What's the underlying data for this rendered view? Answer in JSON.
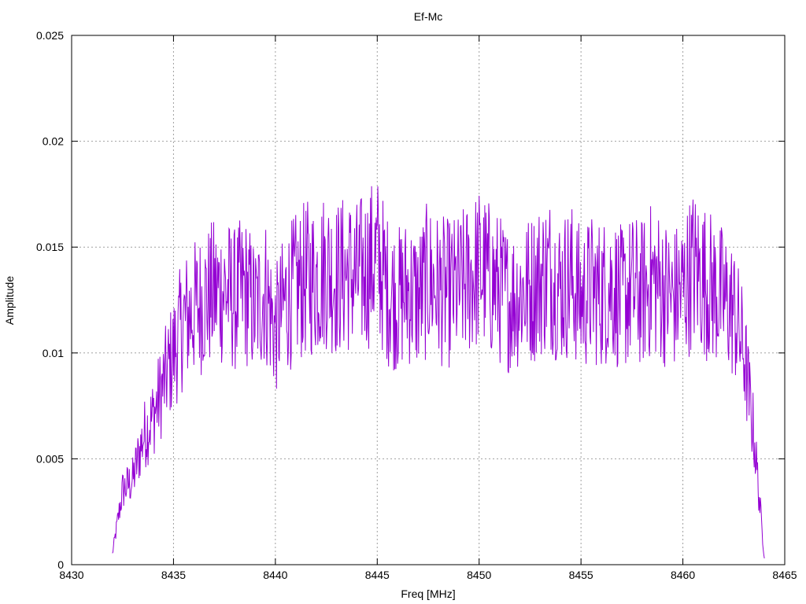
{
  "chart_data": {
    "type": "line",
    "title": "Ef-Mc",
    "xlabel": "Freq [MHz]",
    "ylabel": "Amplitude",
    "xlim": [
      8430,
      8465
    ],
    "ylim": [
      0,
      0.025
    ],
    "grid": true,
    "x_ticks": [
      8430,
      8435,
      8440,
      8445,
      8450,
      8455,
      8460,
      8465
    ],
    "x_tick_labels": [
      "8430",
      "8435",
      "8440",
      "8445",
      "8450",
      "8455",
      "8460",
      "8465"
    ],
    "y_ticks": [
      0,
      0.005,
      0.01,
      0.015,
      0.02,
      0.025
    ],
    "y_tick_labels": [
      "0",
      "0.005",
      "0.01",
      "0.015",
      "0.02",
      "0.025"
    ],
    "series": [
      {
        "color": "#9400d3",
        "x": [
          8432.0,
          8432.5,
          8433.0,
          8433.5,
          8434.0,
          8434.5,
          8435.0,
          8435.5,
          8436.0,
          8436.5,
          8437.0,
          8437.5,
          8438.0,
          8438.5,
          8439.0,
          8439.5,
          8440.0,
          8440.5,
          8441.0,
          8441.5,
          8442.0,
          8442.5,
          8443.0,
          8443.5,
          8444.0,
          8444.5,
          8445.0,
          8445.5,
          8446.0,
          8446.5,
          8447.0,
          8447.5,
          8448.0,
          8448.5,
          8449.0,
          8449.5,
          8450.0,
          8450.5,
          8451.0,
          8451.5,
          8452.0,
          8452.5,
          8453.0,
          8453.5,
          8454.0,
          8454.5,
          8455.0,
          8455.5,
          8456.0,
          8456.5,
          8457.0,
          8457.5,
          8458.0,
          8458.5,
          8459.0,
          8459.5,
          8460.0,
          8460.5,
          8461.0,
          8461.5,
          8462.0,
          8462.5,
          8463.0,
          8463.5,
          8464.0
        ],
        "y": [
          0.0005,
          0.0035,
          0.004,
          0.006,
          0.007,
          0.0085,
          0.01,
          0.0115,
          0.012,
          0.0125,
          0.0128,
          0.013,
          0.0125,
          0.013,
          0.012,
          0.013,
          0.011,
          0.0125,
          0.013,
          0.0135,
          0.0135,
          0.014,
          0.0135,
          0.0138,
          0.0135,
          0.014,
          0.0145,
          0.013,
          0.0125,
          0.013,
          0.0125,
          0.0135,
          0.013,
          0.0128,
          0.013,
          0.0135,
          0.014,
          0.0135,
          0.013,
          0.0125,
          0.0128,
          0.013,
          0.0135,
          0.0138,
          0.013,
          0.0135,
          0.0125,
          0.013,
          0.0128,
          0.0132,
          0.0125,
          0.013,
          0.0128,
          0.0135,
          0.013,
          0.0125,
          0.013,
          0.014,
          0.0135,
          0.013,
          0.0125,
          0.012,
          0.01,
          0.006,
          0.0003
        ]
      }
    ]
  }
}
